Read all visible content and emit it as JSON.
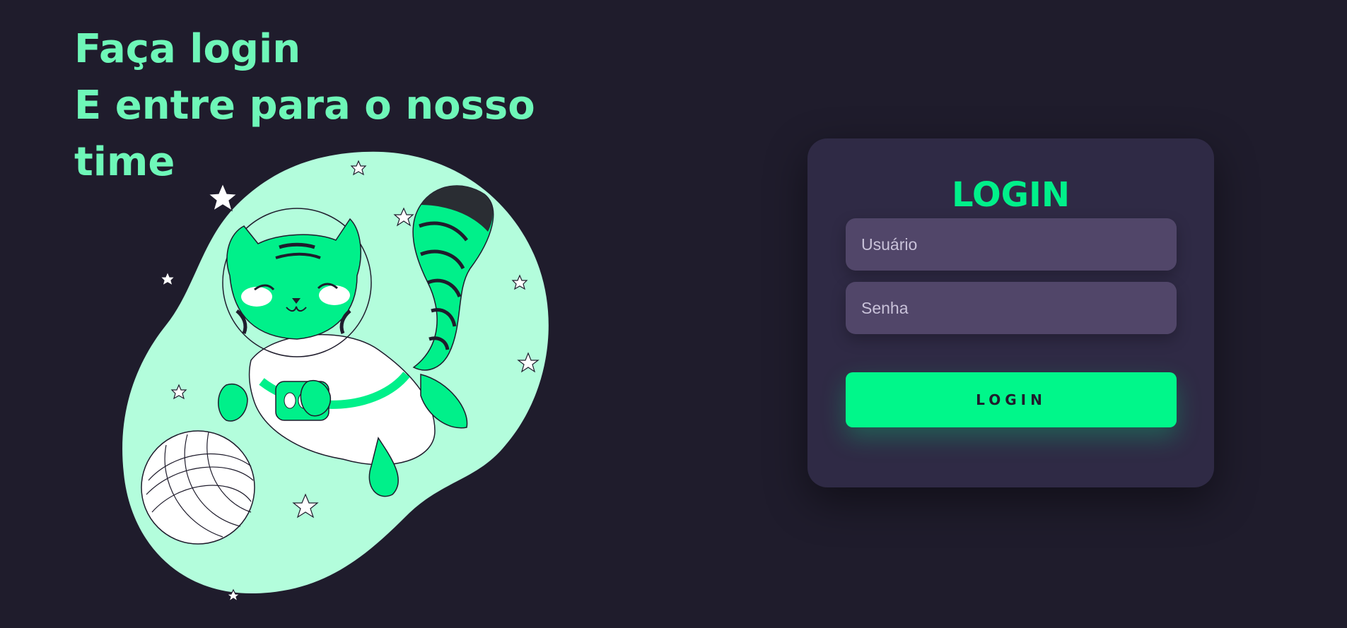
{
  "hero": {
    "line1": "Faça login",
    "line2": "E entre para o nosso time"
  },
  "login_card": {
    "title": "LOGIN",
    "username_placeholder": "Usuário",
    "password_placeholder": "Senha",
    "submit_label": "LOGIN"
  },
  "illustration": {
    "subject": "astronaut-tiger-cat-icon"
  },
  "colors": {
    "background": "#1f1c2c",
    "accent": "#00f08a",
    "headline": "#6ef7b8",
    "card": "#2f2a45",
    "input": "#514669",
    "blob": "#b3fddc"
  }
}
